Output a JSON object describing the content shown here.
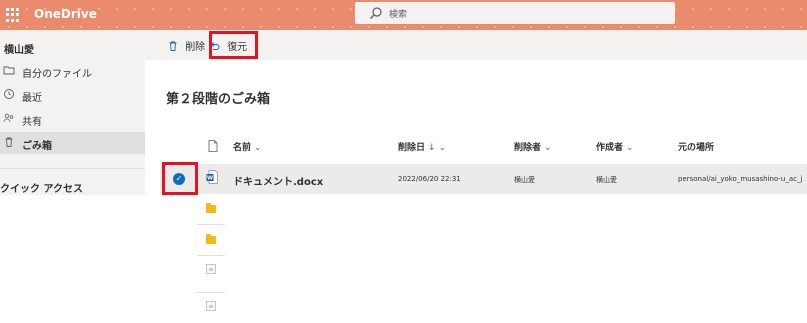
{
  "app": {
    "name": "OneDrive"
  },
  "search": {
    "placeholder": "検索"
  },
  "sidebar": {
    "user": "横山愛",
    "items": [
      {
        "label": "自分のファイル",
        "icon": "folder-icon"
      },
      {
        "label": "最近",
        "icon": "clock-icon"
      },
      {
        "label": "共有",
        "icon": "people-icon"
      },
      {
        "label": "ごみ箱",
        "icon": "trash-icon",
        "selected": true
      }
    ],
    "quick_access": "クイック アクセス"
  },
  "toolbar": {
    "delete_label": "削除",
    "restore_label": "復元"
  },
  "page": {
    "title": "第２段階のごみ箱"
  },
  "table": {
    "columns": {
      "name": "名前",
      "deleted_date": "削除日",
      "deleted_by": "削除者",
      "created_by": "作成者",
      "original_location": "元の場所"
    },
    "sort_indicator": "↓",
    "rows": [
      {
        "name": "ドキュメント.docx",
        "deleted_date": "2022/06/20 22:31",
        "deleted_by": "横山愛",
        "created_by": "横山愛",
        "original_location": "personal/ai_yoko_musashino-u_ac_j",
        "type": "word",
        "selected": true
      },
      {
        "type": "folder"
      },
      {
        "type": "folder"
      },
      {
        "type": "file"
      },
      {
        "type": "file"
      }
    ]
  },
  "colors": {
    "suite_bar": "#e98b6c",
    "accent": "#0f6cbd",
    "highlight": "#e81123"
  }
}
